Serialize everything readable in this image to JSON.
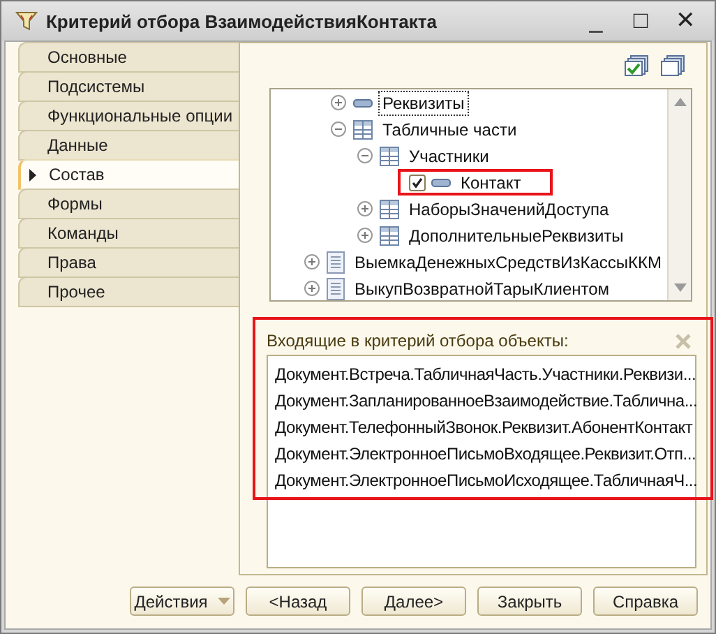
{
  "window": {
    "title": "Критерий отбора ВзаимодействияКонтакта",
    "controls": [
      "_",
      "□",
      "✕"
    ]
  },
  "tabs": [
    {
      "label": "Основные",
      "selected": false
    },
    {
      "label": "Подсистемы",
      "selected": false
    },
    {
      "label": "Функциональные опции",
      "selected": false
    },
    {
      "label": "Данные",
      "selected": false
    },
    {
      "label": "Состав",
      "selected": true
    },
    {
      "label": "Формы",
      "selected": false
    },
    {
      "label": "Команды",
      "selected": false
    },
    {
      "label": "Права",
      "selected": false
    },
    {
      "label": "Прочее",
      "selected": false
    }
  ],
  "tree": {
    "items": [
      {
        "children": [
          {
            "label": "Реквизиты",
            "kind": "attribute",
            "expanded": false,
            "focused": true
          },
          {
            "label": "Табличные части",
            "kind": "table",
            "expanded": true,
            "children": [
              {
                "label": "Участники",
                "kind": "table",
                "expanded": true,
                "children": [
                  {
                    "label": "Контакт",
                    "kind": "attribute",
                    "checked": true,
                    "highlighted": true
                  }
                ]
              },
              {
                "label": "НаборыЗначенийДоступа",
                "kind": "table",
                "expanded": false
              },
              {
                "label": "ДополнительныеРеквизиты",
                "kind": "table",
                "expanded": false
              }
            ]
          }
        ]
      },
      {
        "label": "ВыемкаДенежныхСредствИзКассыККМ",
        "kind": "document",
        "expanded": false
      },
      {
        "label": "ВыкупВозвратнойТарыКлиентом",
        "kind": "document",
        "expanded": false
      }
    ]
  },
  "objects_panel": {
    "title": "Входящие в критерий отбора объекты:",
    "highlighted": true,
    "items": [
      "Документ.Встреча.ТабличнаяЧасть.Участники.Реквизи...",
      "Документ.ЗапланированноеВзаимодействие.Таблична...",
      "Документ.ТелефонныйЗвонок.Реквизит.АбонентКонтакт",
      "Документ.ЭлектронноеПисьмоВходящее.Реквизит.Отп...",
      "Документ.ЭлектронноеПисьмоИсходящее.ТабличнаяЧ..."
    ]
  },
  "buttons": [
    {
      "label": "Действия",
      "kind": "menu"
    },
    {
      "label": "<Назад",
      "kind": "plain"
    },
    {
      "label": "Далее>",
      "kind": "plain"
    },
    {
      "label": "Закрыть",
      "kind": "plain"
    },
    {
      "label": "Справка",
      "kind": "plain"
    }
  ]
}
